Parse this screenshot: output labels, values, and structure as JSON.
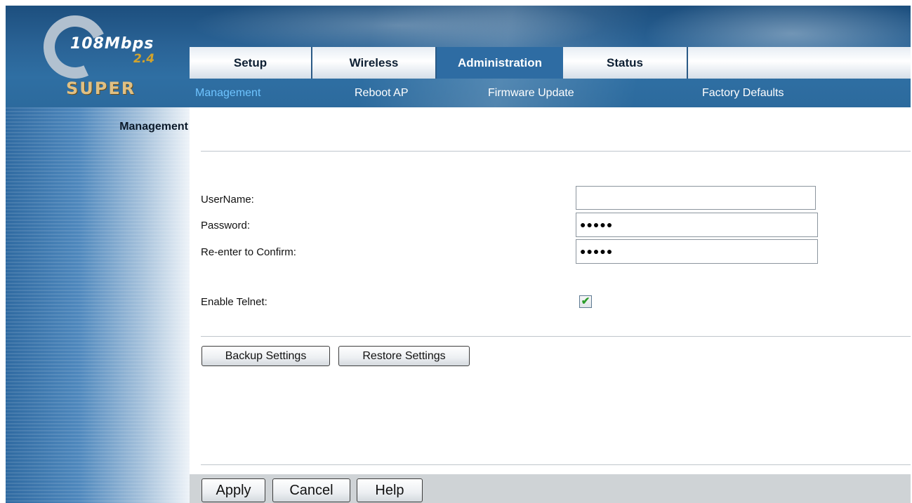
{
  "logo": {
    "speed": "108Mbps",
    "band": "2.4",
    "brand": "SUPER"
  },
  "tabs": [
    {
      "label": "Setup",
      "active": false
    },
    {
      "label": "Wireless",
      "active": false
    },
    {
      "label": "Administration",
      "active": true
    },
    {
      "label": "Status",
      "active": false
    }
  ],
  "subnav": [
    {
      "label": "Management",
      "active": true
    },
    {
      "label": "Reboot AP",
      "active": false
    },
    {
      "label": "Firmware Update",
      "active": false
    },
    {
      "label": "Factory Defaults",
      "active": false
    }
  ],
  "sidebar": {
    "title": "Management"
  },
  "form": {
    "username_label": "UserName:",
    "username_value": "",
    "password_label": "Password:",
    "password_value": "●●●●●",
    "confirm_label": "Re-enter to Confirm:",
    "confirm_value": "●●●●●",
    "telnet_label": "Enable Telnet:",
    "telnet_checked": true,
    "telnet_mark": "✔"
  },
  "buttons": {
    "backup": "Backup Settings",
    "restore": "Restore Settings",
    "apply": "Apply",
    "cancel": "Cancel",
    "help": "Help"
  }
}
